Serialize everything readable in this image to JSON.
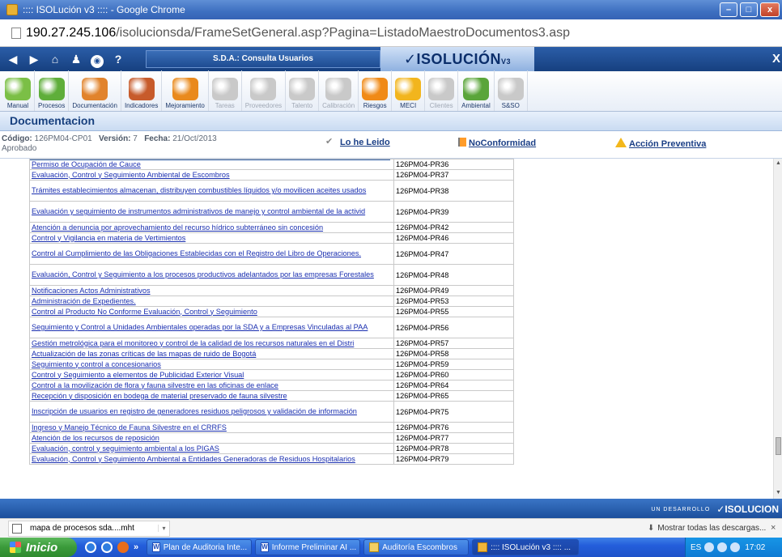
{
  "window": {
    "title": ":::: ISOLución v3 :::: - Google Chrome"
  },
  "address": {
    "host": "190.27.245.106",
    "path": "/isolucionsda/FrameSetGeneral.asp?Pagina=ListadoMaestroDocumentos3.asp"
  },
  "header": {
    "app_title": "S.D.A.: Consulta Usuarios",
    "logo": "ISOLUCIÓN",
    "logo_version": "V3",
    "close_label": "X"
  },
  "toolbar": {
    "items": [
      {
        "label": "Manual",
        "icon": "book-icon",
        "enabled": true,
        "color": "#7bbf46"
      },
      {
        "label": "Procesos",
        "icon": "process-cubes-icon",
        "enabled": true,
        "color": "#5fae3a"
      },
      {
        "label": "Documentación",
        "icon": "documents-icon",
        "enabled": true,
        "color": "#e1832c"
      },
      {
        "label": "Indicadores",
        "icon": "chart-icon",
        "enabled": true,
        "color": "#c75b2b"
      },
      {
        "label": "Mejoramiento",
        "icon": "compass-icon",
        "enabled": true,
        "color": "#e98a1d"
      },
      {
        "label": "Tareas",
        "icon": "laptop-icon",
        "enabled": false,
        "color": "#c9c9c9"
      },
      {
        "label": "Proveedores",
        "icon": "supplier-icon",
        "enabled": false,
        "color": "#c9c9c9"
      },
      {
        "label": "Talento",
        "icon": "talent-icon",
        "enabled": false,
        "color": "#c9c9c9"
      },
      {
        "label": "Calibración",
        "icon": "calibration-icon",
        "enabled": false,
        "color": "#c9c9c9"
      },
      {
        "label": "Riesgos",
        "icon": "hardhat-icon",
        "enabled": true,
        "color": "#f08a17"
      },
      {
        "label": "MECI",
        "icon": "meci-icon",
        "enabled": true,
        "color": "#f2b51d"
      },
      {
        "label": "Clientes",
        "icon": "clients-icon",
        "enabled": false,
        "color": "#c9c9c9"
      },
      {
        "label": "Ambiental",
        "icon": "leaves-icon",
        "enabled": true,
        "color": "#5aa53a"
      },
      {
        "label": "S&SO",
        "icon": "safety-icon",
        "enabled": true,
        "color": "#c9c9c9"
      }
    ]
  },
  "section": {
    "title": "Documentacion"
  },
  "docinfo": {
    "code_label": "Código:",
    "code": "126PM04-CP01",
    "version_label": "Versión:",
    "version": "7",
    "date_label": "Fecha:",
    "date": "21/Oct/2013",
    "status": "Aprobado",
    "read_label": "Lo he Leido",
    "nonconformity_label": "NoConformidad",
    "preventive_label": "Acción Preventiva"
  },
  "table": {
    "rows": [
      {
        "name": "Permiso de Ocupación de Cauce",
        "code": "126PM04-PR36",
        "tall": false
      },
      {
        "name": "Evaluación, Control y Seguimiento Ambiental de Escombros",
        "code": "126PM04-PR37",
        "tall": false
      },
      {
        "name": "Trámites establecimientos almacenan, distribuyen combustibles líquidos y/o movilicen aceites usados",
        "code": "126PM04-PR38",
        "tall": true
      },
      {
        "name": "Evaluación y seguimiento de instrumentos administrativos de manejo y control ambiental de la activid",
        "code": "126PM04-PR39",
        "tall": true
      },
      {
        "name": "Atención a denuncia por aprovechamiento del recurso hídrico subterráneo sin concesión",
        "code": "126PM04-PR42",
        "tall": false
      },
      {
        "name": "Control y Vigilancia en materia de Vertimientos",
        "code": "126PM04-PR46",
        "tall": false
      },
      {
        "name": "Control al Cumplimiento de las Obligaciones Establecidas con el Registro del Libro de Operaciones.",
        "code": "126PM04-PR47",
        "tall": true
      },
      {
        "name": "Evaluación, Control y Seguimiento a los procesos productivos adelantados por las empresas Forestales",
        "code": "126PM04-PR48",
        "tall": true
      },
      {
        "name": "Notificaciones Actos Administrativos",
        "code": "126PM04-PR49",
        "tall": false
      },
      {
        "name": "Administración de Expedientes.",
        "code": "126PM04-PR53",
        "tall": false
      },
      {
        "name": "Control al Producto No Conforme Evaluación, Control y Seguimiento",
        "code": "126PM04-PR55",
        "tall": false
      },
      {
        "name": "Seguimiento y Control a Unidades Ambientales operadas por la SDA y a Empresas Vinculadas al PAA",
        "code": "126PM04-PR56",
        "tall": true
      },
      {
        "name": "Gestión metrológica para el monitoreo y control de la calidad de los recursos naturales en el Distri",
        "code": "126PM04-PR57",
        "tall": false
      },
      {
        "name": "Actualización de las zonas críticas de las mapas de ruido de Bogotá",
        "code": "126PM04-PR58",
        "tall": false
      },
      {
        "name": "Seguimiento y control a concesionarios",
        "code": "126PM04-PR59",
        "tall": false
      },
      {
        "name": "Control y Seguimiento a elementos de Publicidad Exterior Visual",
        "code": "126PM04-PR60",
        "tall": false
      },
      {
        "name": "Control a la movilización de flora y fauna silvestre en las oficinas de enlace",
        "code": "126PM04-PR64",
        "tall": false
      },
      {
        "name": "Recepción y disposición en bodega de material preservado de fauna silvestre",
        "code": "126PM04-PR65",
        "tall": false
      },
      {
        "name": "Inscripción de usuarios en registro de generadores residuos peligrosos y validación de información",
        "code": "126PM04-PR75",
        "tall": true
      },
      {
        "name": "Ingreso y Manejo Técnico de Fauna Silvestre en el CRRFS",
        "code": "126PM04-PR76",
        "tall": false
      },
      {
        "name": "Atención de los recursos de reposición",
        "code": "126PM04-PR77",
        "tall": false
      },
      {
        "name": "Evaluación, control y seguimiento ambiental a los PIGAS",
        "code": "126PM04-PR78",
        "tall": false
      },
      {
        "name": "Evaluación, Control y Seguimiento Ambiental a Entidades Generadoras de Residuos Hospitalarios",
        "code": "126PM04-PR79",
        "tall": false
      }
    ]
  },
  "footer": {
    "prefix": "UN DESARROLLO",
    "brand": "ISOLUCION"
  },
  "downloads": {
    "file": "mapa de procesos sda....mht",
    "show_all": "Mostrar todas las descargas...",
    "close": "×"
  },
  "taskbar": {
    "start": "Inicio",
    "overflow": "»",
    "tasks": [
      {
        "label": "Plan de Auditoria Inte...",
        "icon": "word-icon",
        "glyph": "W",
        "active": false
      },
      {
        "label": "Informe Preliminar AI ...",
        "icon": "word-icon",
        "glyph": "W",
        "active": false
      },
      {
        "label": "Auditoría Escombros",
        "icon": "folder-icon",
        "glyph": "",
        "active": false
      },
      {
        "label": ":::: ISOLución v3 :::: ...",
        "icon": "chrome-icon",
        "glyph": "",
        "active": true
      }
    ],
    "lang": "ES",
    "clock": "17:02"
  }
}
